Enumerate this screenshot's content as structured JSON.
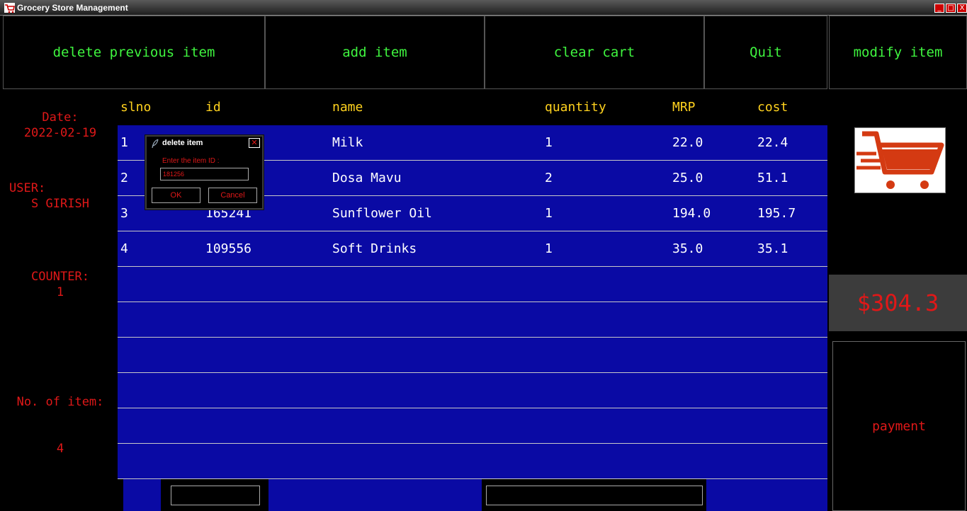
{
  "window": {
    "title": "Grocery Store Management",
    "min_icon": "_",
    "max_icon": "□",
    "close_icon": "X"
  },
  "toolbar": {
    "delete_previous_label": "delete previous item",
    "add_item_label": "add item",
    "clear_cart_label": "clear cart",
    "quit_label": "Quit",
    "modify_item_label": "modify item"
  },
  "info": {
    "date_label": "Date:",
    "date_value": "2022-02-19",
    "user_label": "USER:",
    "user_value": "S GIRISH",
    "counter_label": "COUNTER:",
    "counter_value": "1",
    "items_label": "No. of item:",
    "items_value": "4"
  },
  "table": {
    "headers": [
      "slno",
      "id",
      "name",
      "quantity",
      "MRP",
      "cost"
    ],
    "rows": [
      {
        "slno": "1",
        "id": "",
        "name": "Milk",
        "quantity": "1",
        "mrp": "22.0",
        "cost": "22.4"
      },
      {
        "slno": "2",
        "id": "",
        "name": "Dosa Mavu",
        "quantity": "2",
        "mrp": "25.0",
        "cost": "51.1"
      },
      {
        "slno": "3",
        "id": "165241",
        "name": "Sunflower Oil",
        "quantity": "1",
        "mrp": "194.0",
        "cost": "195.7"
      },
      {
        "slno": "4",
        "id": "109556",
        "name": "Soft Drinks",
        "quantity": "1",
        "mrp": "35.0",
        "cost": "35.1"
      }
    ]
  },
  "total": "$304.3",
  "payment_label": "payment",
  "dialog": {
    "title": "delete item",
    "close_icon": "✕",
    "prompt": "Enter the item ID :",
    "input_value": "181256",
    "ok_label": "OK",
    "cancel_label": "Cancel"
  },
  "colors": {
    "accent_green": "#3ff43f",
    "label_red": "#e01818",
    "header_yellow": "#ffd21e",
    "table_blue": "#0a0aa4",
    "cart_orange": "#d43a12"
  }
}
